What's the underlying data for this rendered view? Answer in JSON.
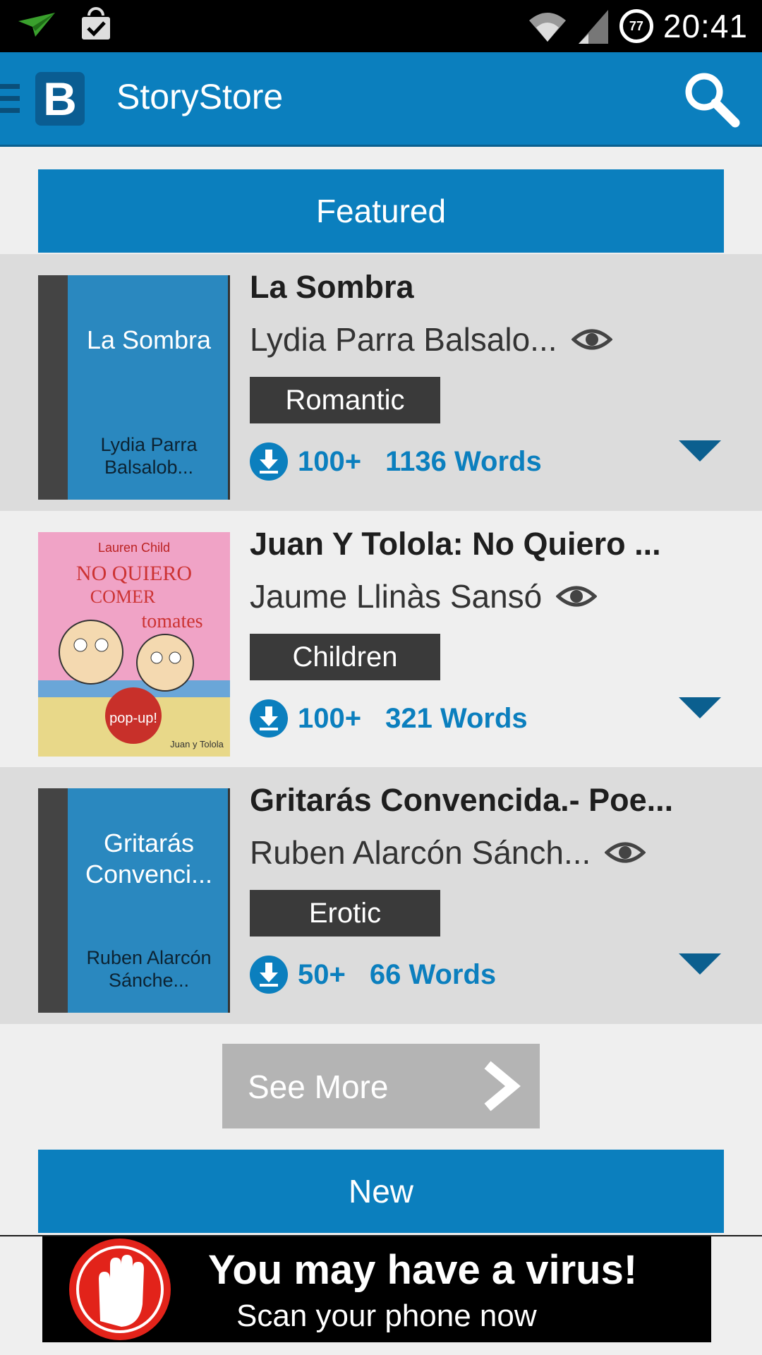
{
  "status_bar": {
    "time": "20:41",
    "battery": "77",
    "icons": [
      "send-notification-icon",
      "shopping-bag-icon",
      "wifi-icon",
      "signal-icon",
      "battery-icon"
    ]
  },
  "app_bar": {
    "logo_letter": "B",
    "title": "StoryStore",
    "icons": [
      "drawer-icon",
      "search-icon"
    ]
  },
  "sections": {
    "featured": "Featured",
    "new": "New"
  },
  "stories": [
    {
      "title": "La Sombra",
      "author": "Lydia Parra Balsalo...",
      "genre": "Romantic",
      "downloads": "100+",
      "words": "1136 Words",
      "cover_title": "La Sombra",
      "cover_author": "Lydia Parra Balsalob..."
    },
    {
      "title": "Juan Y Tolola: No Quiero ...",
      "author": "Jaume Llinàs Sansó",
      "genre": "Children",
      "downloads": "100+",
      "words": "321 Words",
      "cover_image_text": [
        "Lauren Child",
        "NO QUIERO",
        "COMER",
        "tomates",
        "pop-up!",
        "Juan y Tolola"
      ]
    },
    {
      "title": "Gritarás Convencida.- Poe...",
      "author": "Ruben Alarcón Sánch...",
      "genre": "Erotic",
      "downloads": "50+",
      "words": "66 Words",
      "cover_title": "Gritarás Convenci...",
      "cover_author": "Ruben Alarcón Sánche..."
    }
  ],
  "see_more": "See More",
  "ad": {
    "line1": "You may have a virus!",
    "line2": "Scan your phone now"
  },
  "colors": {
    "primary": "#0b7fbe",
    "tag_bg": "#3a3a3a",
    "row_alt": "#dcdcdc",
    "background": "#efefef"
  }
}
